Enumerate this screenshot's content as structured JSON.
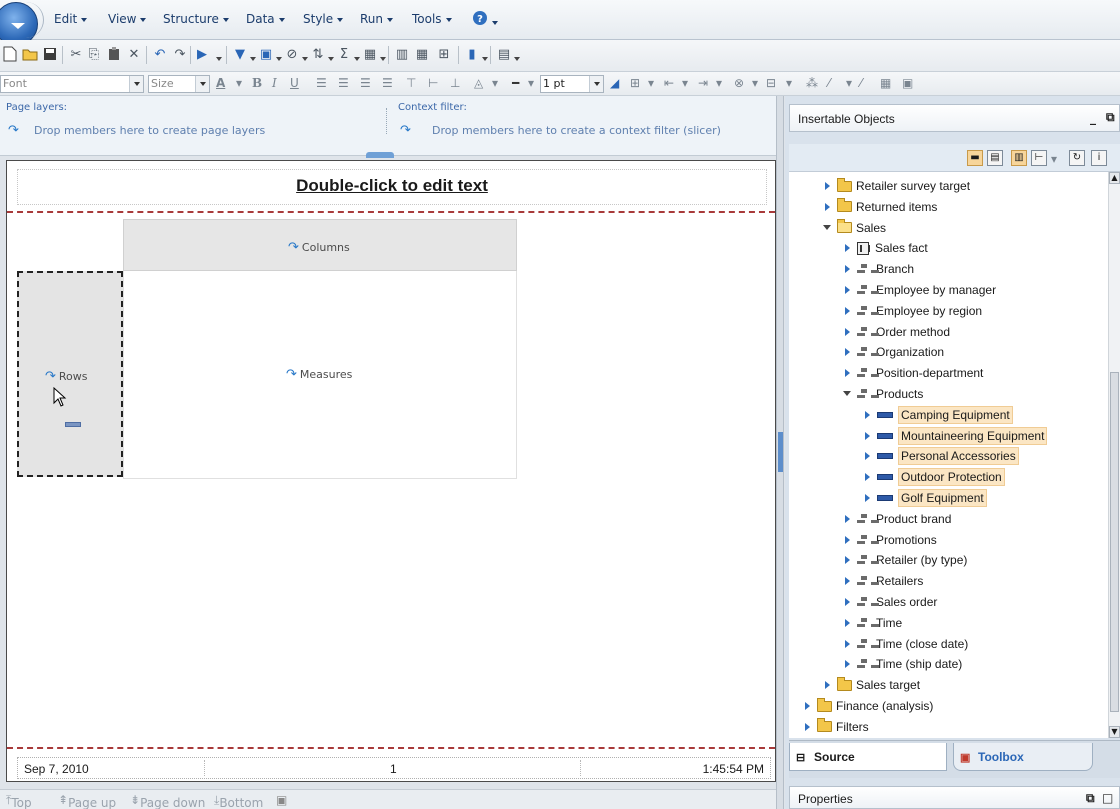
{
  "menubar": {
    "items": [
      {
        "label": "Edit"
      },
      {
        "label": "View"
      },
      {
        "label": "Structure"
      },
      {
        "label": "Data"
      },
      {
        "label": "Style"
      },
      {
        "label": "Run"
      },
      {
        "label": "Tools"
      }
    ]
  },
  "format_toolbar": {
    "font_placeholder": "Font",
    "size_placeholder": "Size",
    "line_width": "1 pt"
  },
  "drop_zones": {
    "page_layers_label": "Page layers:",
    "page_layers_hint": "Drop members here to create page layers",
    "context_filter_label": "Context filter:",
    "context_filter_hint": "Drop members here to create a context filter (slicer)"
  },
  "report": {
    "title": "Double-click to edit text",
    "columns_label": "Columns",
    "rows_label": "Rows",
    "measures_label": "Measures",
    "footer_date": "Sep 7, 2010",
    "footer_page": "1",
    "footer_time": "1:45:54 PM"
  },
  "pager": {
    "top": "Top",
    "page_up": "Page up",
    "page_down": "Page down",
    "bottom": "Bottom"
  },
  "insertable_objects": {
    "title": "Insertable Objects",
    "tree": [
      {
        "label": "Retailer survey target",
        "type": "folder",
        "state": "closed",
        "indent": 0
      },
      {
        "label": "Returned items",
        "type": "folder",
        "state": "closed",
        "indent": 0
      },
      {
        "label": "Sales",
        "type": "folder",
        "state": "open",
        "indent": 0
      },
      {
        "label": "Sales fact",
        "type": "fact",
        "state": "closed",
        "indent": 1
      },
      {
        "label": "Branch",
        "type": "dimension",
        "state": "closed",
        "indent": 1
      },
      {
        "label": "Employee by manager",
        "type": "dimension",
        "state": "closed",
        "indent": 1
      },
      {
        "label": "Employee by region",
        "type": "dimension",
        "state": "closed",
        "indent": 1
      },
      {
        "label": "Order method",
        "type": "dimension",
        "state": "closed",
        "indent": 1
      },
      {
        "label": "Organization",
        "type": "dimension",
        "state": "closed",
        "indent": 1
      },
      {
        "label": "Position-department",
        "type": "dimension",
        "state": "closed",
        "indent": 1
      },
      {
        "label": "Products",
        "type": "dimension",
        "state": "open",
        "indent": 1
      },
      {
        "label": "Camping Equipment",
        "type": "level",
        "state": "closed",
        "indent": 2,
        "highlight": true
      },
      {
        "label": "Mountaineering Equipment",
        "type": "level",
        "state": "closed",
        "indent": 2,
        "highlight": true
      },
      {
        "label": "Personal Accessories",
        "type": "level",
        "state": "closed",
        "indent": 2,
        "highlight": true
      },
      {
        "label": "Outdoor Protection",
        "type": "level",
        "state": "closed",
        "indent": 2,
        "highlight": true
      },
      {
        "label": "Golf Equipment",
        "type": "level",
        "state": "closed",
        "indent": 2,
        "highlight": true
      },
      {
        "label": "Product brand",
        "type": "dimension",
        "state": "closed",
        "indent": 1
      },
      {
        "label": "Promotions",
        "type": "dimension",
        "state": "closed",
        "indent": 1
      },
      {
        "label": "Retailer (by type)",
        "type": "dimension",
        "state": "closed",
        "indent": 1
      },
      {
        "label": "Retailers",
        "type": "dimension",
        "state": "closed",
        "indent": 1
      },
      {
        "label": "Sales order",
        "type": "dimension",
        "state": "closed",
        "indent": 1
      },
      {
        "label": "Time",
        "type": "dimension",
        "state": "closed",
        "indent": 1
      },
      {
        "label": "Time (close date)",
        "type": "dimension",
        "state": "closed",
        "indent": 1
      },
      {
        "label": "Time (ship date)",
        "type": "dimension",
        "state": "closed",
        "indent": 1
      },
      {
        "label": "Sales target",
        "type": "folder",
        "state": "closed",
        "indent": 0
      },
      {
        "label": "Finance (analysis)",
        "type": "folder",
        "state": "closed",
        "indent": -1
      },
      {
        "label": "Filters",
        "type": "folder",
        "state": "closed",
        "indent": -1
      }
    ]
  },
  "right_tabs": {
    "source": "Source",
    "toolbox": "Toolbox"
  },
  "properties": {
    "title": "Properties"
  }
}
